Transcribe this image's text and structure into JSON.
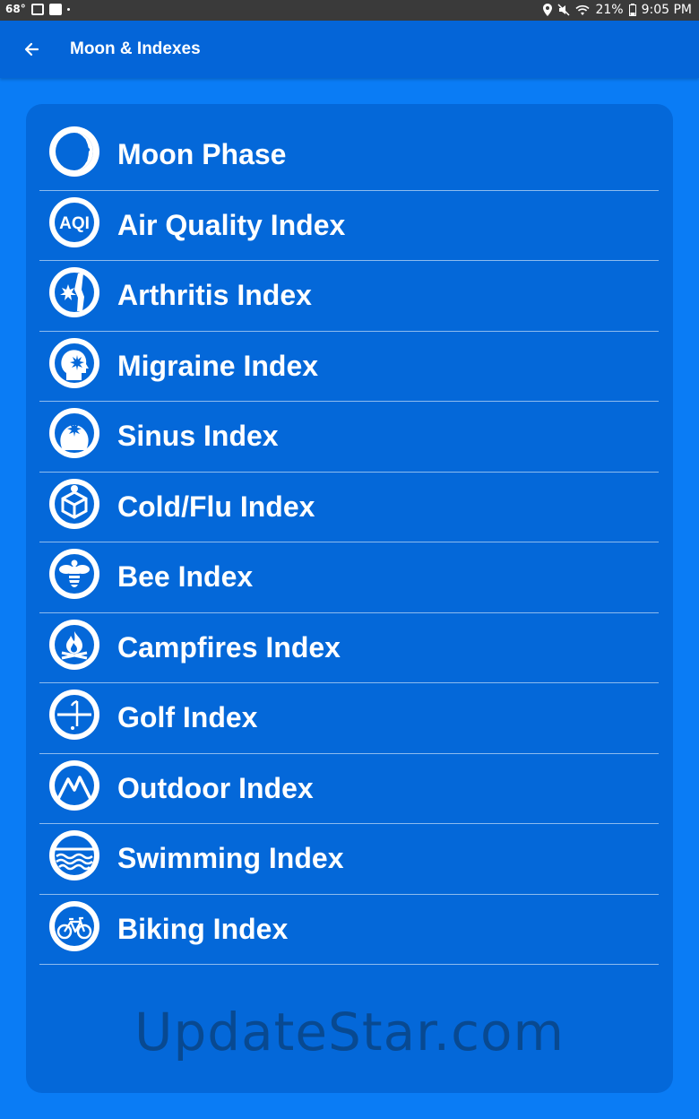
{
  "status_bar": {
    "temperature": "68°",
    "battery": "21%",
    "time": "9:05 PM"
  },
  "app_bar": {
    "title": "Moon & Indexes"
  },
  "list": {
    "items": [
      {
        "label": "Moon Phase",
        "icon": "moon-icon"
      },
      {
        "label": "Air Quality Index",
        "icon": "aqi-icon"
      },
      {
        "label": "Arthritis Index",
        "icon": "arthritis-icon"
      },
      {
        "label": "Migraine Index",
        "icon": "migraine-icon"
      },
      {
        "label": "Sinus Index",
        "icon": "sinus-icon"
      },
      {
        "label": "Cold/Flu Index",
        "icon": "cold-flu-icon"
      },
      {
        "label": "Bee Index",
        "icon": "bee-icon"
      },
      {
        "label": "Campfires Index",
        "icon": "campfire-icon"
      },
      {
        "label": "Golf Index",
        "icon": "golf-icon"
      },
      {
        "label": "Outdoor Index",
        "icon": "mountain-icon"
      },
      {
        "label": "Swimming Index",
        "icon": "waves-icon"
      },
      {
        "label": "Biking Index",
        "icon": "bicycle-icon"
      }
    ]
  },
  "watermark": "UpdateStar.com",
  "colors": {
    "background": "#0a7cf5",
    "app_bar": "#0465d8",
    "card": "#0468d9",
    "status_bar": "#3a3a3a"
  }
}
